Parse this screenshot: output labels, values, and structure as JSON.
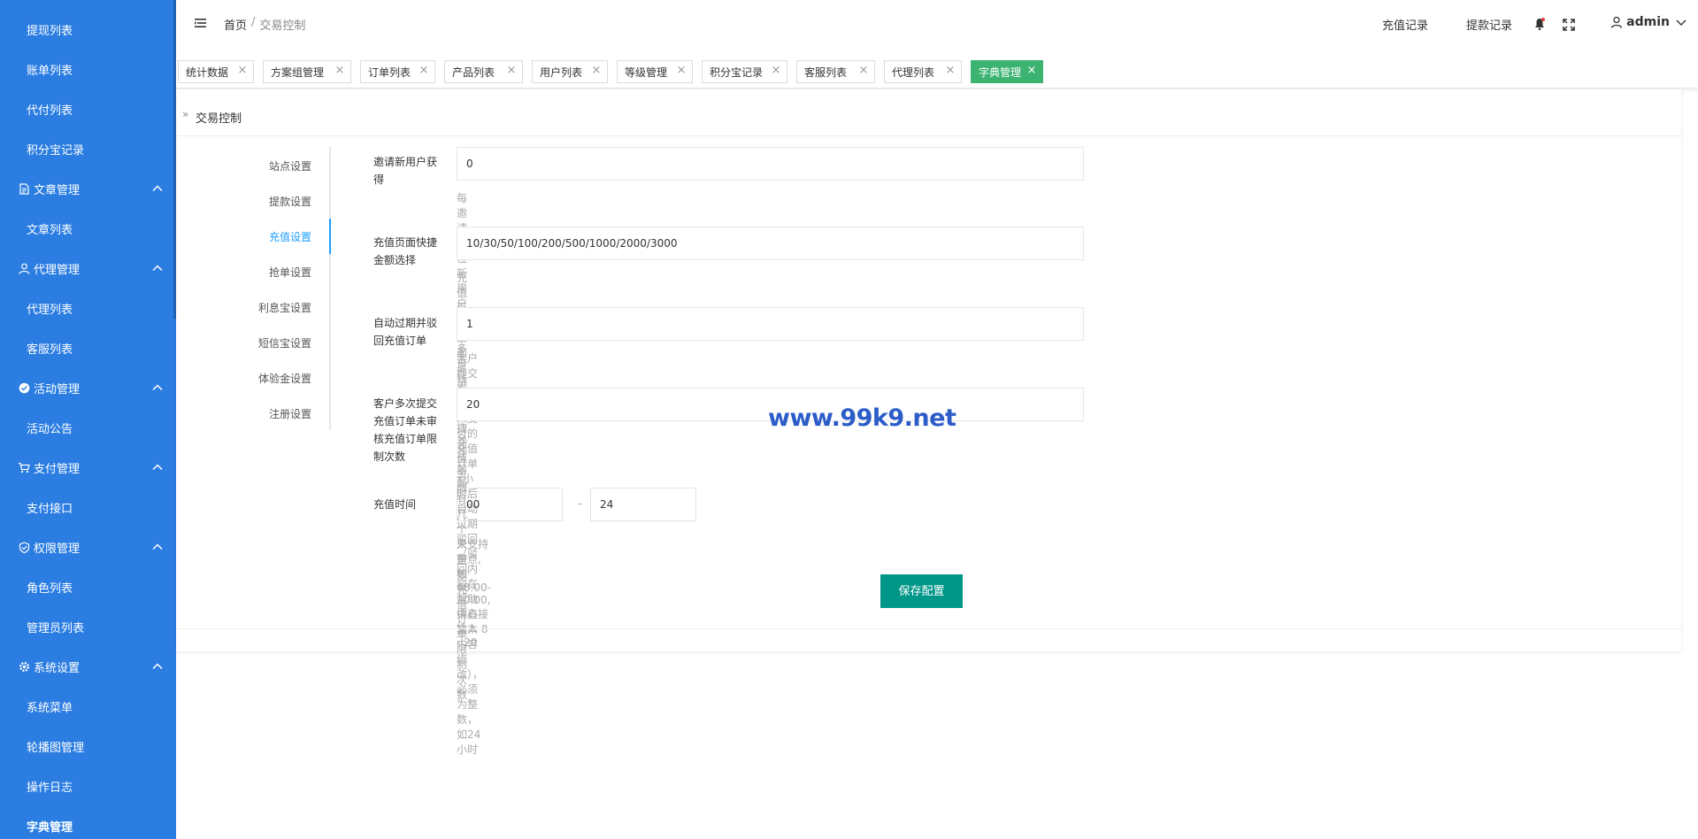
{
  "sidebar": {
    "items": [
      {
        "type": "sub",
        "label": "提现列表"
      },
      {
        "type": "sub",
        "label": "账单列表"
      },
      {
        "type": "sub",
        "label": "代付列表"
      },
      {
        "type": "sub",
        "label": "积分宝记录"
      },
      {
        "type": "group",
        "label": "文章管理",
        "icon": "document-icon"
      },
      {
        "type": "sub",
        "label": "文章列表"
      },
      {
        "type": "group",
        "label": "代理管理",
        "icon": "user-icon"
      },
      {
        "type": "sub",
        "label": "代理列表"
      },
      {
        "type": "sub",
        "label": "客服列表"
      },
      {
        "type": "group",
        "label": "活动管理",
        "icon": "activity-icon"
      },
      {
        "type": "sub",
        "label": "活动公告"
      },
      {
        "type": "group",
        "label": "支付管理",
        "icon": "cart-icon"
      },
      {
        "type": "sub",
        "label": "支付接口"
      },
      {
        "type": "group",
        "label": "权限管理",
        "icon": "shield-icon"
      },
      {
        "type": "sub",
        "label": "角色列表"
      },
      {
        "type": "sub",
        "label": "管理员列表"
      },
      {
        "type": "group",
        "label": "系统设置",
        "icon": "gear-icon"
      },
      {
        "type": "sub",
        "label": "系统菜单"
      },
      {
        "type": "sub",
        "label": "轮播图管理"
      },
      {
        "type": "sub",
        "label": "操作日志"
      },
      {
        "type": "sub",
        "label": "字典管理",
        "active": true
      }
    ]
  },
  "header": {
    "breadcrumb_home": "首页",
    "breadcrumb_sep": "/",
    "breadcrumb_current": "交易控制",
    "link_recharge": "充值记录",
    "link_withdraw": "提款记录",
    "username": "admin"
  },
  "tabs": [
    {
      "label": "统计数据"
    },
    {
      "label": "方案组管理"
    },
    {
      "label": "订单列表"
    },
    {
      "label": "产品列表"
    },
    {
      "label": "用户列表"
    },
    {
      "label": "等级管理"
    },
    {
      "label": "积分宝记录"
    },
    {
      "label": "客服列表"
    },
    {
      "label": "代理列表"
    },
    {
      "label": "字典管理",
      "active": true
    }
  ],
  "card": {
    "title": "交易控制",
    "vtabs": [
      "站点设置",
      "提款设置",
      "充值设置",
      "抢单设置",
      "利息宝设置",
      "短信宝设置",
      "体验金设置",
      "注册设置"
    ],
    "active_vtab": "充值设置"
  },
  "form": {
    "invite_label": "邀请新用户获得",
    "invite_value": "0",
    "invite_help": "每邀请一位新用户获得多少钱",
    "quick_label": "充值页面快捷金额选择",
    "quick_value": "10/30/50/100/200/500/1000/2000/3000",
    "quick_help": "充值页面 上面显示的 快捷充值金额",
    "expire_label": "自动过期并驳回充值订单",
    "expire_value": "1",
    "expire_help": "客户提交充值，未支付的充值订单x小时后自动过期驳回（驳回内容在帮助中心-文本内容修改），必须为整数，如24小时",
    "multi_label": "客户多次提交充值订单未审核充值订单限制次数",
    "multi_value": "20",
    "multi_help": "允许前面有几个未审核充值订单限制次数",
    "time_label": "充值时间",
    "time_start": "00",
    "time_dash": "-",
    "time_end": "24",
    "time_help": "只支持整点, 如08:00-20:00,请直接输入 8 - 20",
    "save_label": "保存配置"
  },
  "watermark": "www.99k9.net"
}
